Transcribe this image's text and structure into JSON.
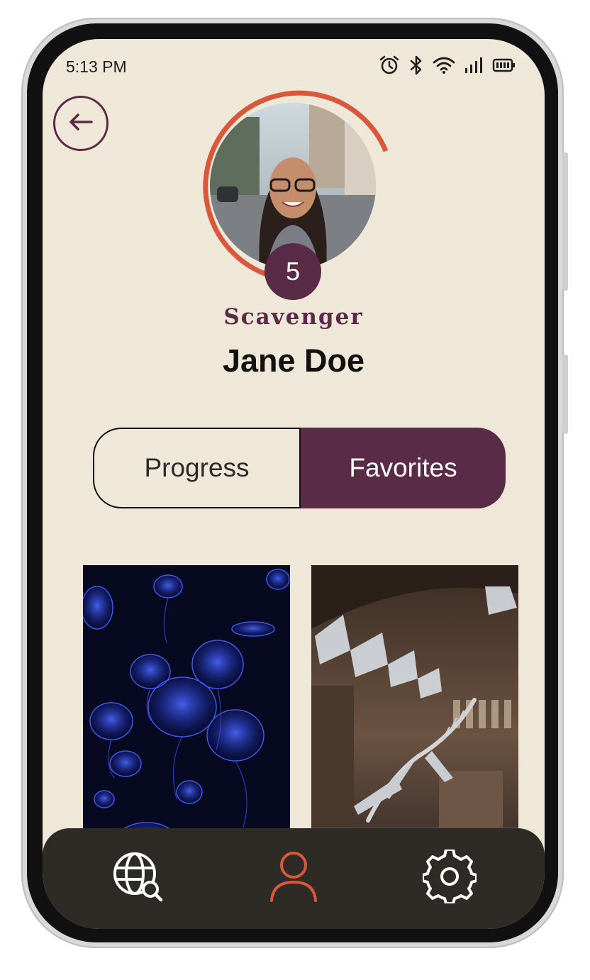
{
  "status_bar": {
    "time": "5:13 PM",
    "icons": [
      "alarm-icon",
      "bluetooth-icon",
      "wifi-icon",
      "signal-icon",
      "battery-icon"
    ]
  },
  "profile": {
    "level": "5",
    "rank": "Scavenger",
    "name": "Jane Doe",
    "progress_ring_color": "#d9573a"
  },
  "tabs": [
    {
      "label": "Progress",
      "active": false
    },
    {
      "label": "Favorites",
      "active": true
    }
  ],
  "favorites": [
    {
      "subject": "jellyfish-photo"
    },
    {
      "subject": "museum-whale-skeleton-photo"
    }
  ],
  "nav": [
    {
      "icon": "globe-search-icon",
      "active": false
    },
    {
      "icon": "profile-icon",
      "active": true
    },
    {
      "icon": "settings-icon",
      "active": false
    }
  ],
  "colors": {
    "background": "#efe8d8",
    "accent": "#5a2b46",
    "active_nav": "#d9573a",
    "nav_bg": "#2e2b26"
  }
}
